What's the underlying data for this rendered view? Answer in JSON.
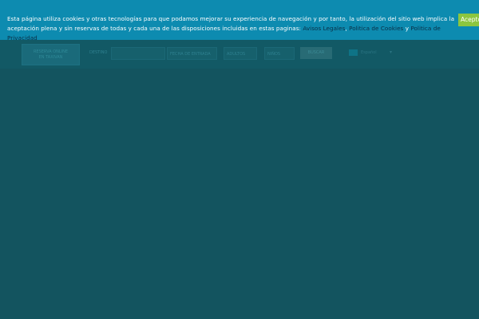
{
  "cookie_banner": {
    "text_part1": "Esta página utiliza cookies y otras tecnologías para que podamos mejorar su experiencia de navegación y por tanto, la utilización del sitio web implica la aceptación plena y sin reservas de todas y cada una de las disposiciones incluidas en estas paginas: ",
    "link_legal": "Avisos Legales",
    "sep1": ", ",
    "link_cookies": "Politica de Cookies",
    "sep2": " y ",
    "link_privacy": "Politica de Privacidad",
    "accept_label": "Acepto"
  },
  "search": {
    "booking_label": "RESERVA ONLINE\nEN TAXIVAN",
    "destination_label": "DESTINO",
    "dates_label": "FECHA DE ENTRADA",
    "adults_label": "ADULTOS",
    "children_label": "NIÑOS",
    "search_button": "BUSCAR",
    "language": "Español"
  },
  "colors": {
    "banner_bg": "#0d8bb0",
    "accept_bg": "#8cc63f",
    "overlay": "#13545f"
  }
}
